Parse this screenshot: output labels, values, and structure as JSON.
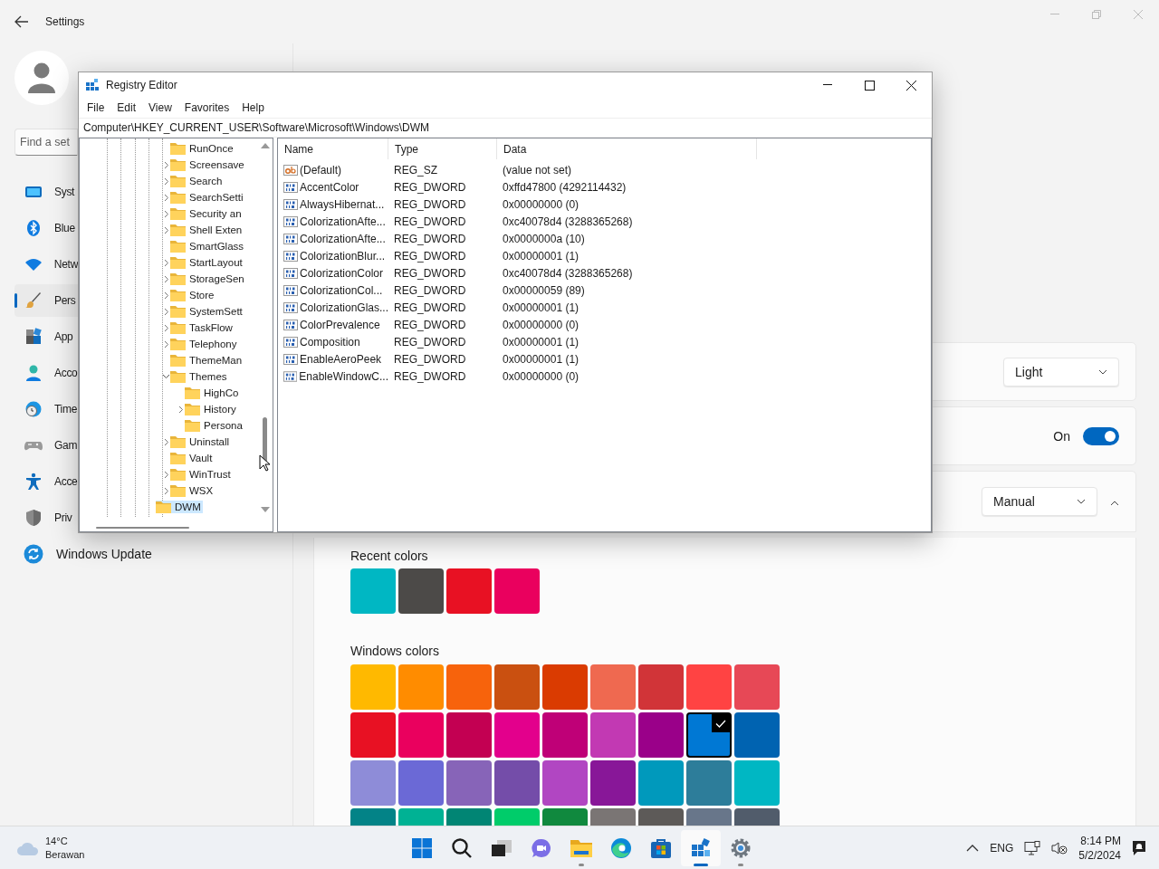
{
  "settings": {
    "title": "Settings",
    "search": {
      "placeholder": "Find a set"
    },
    "nav": [
      {
        "label": "Syst",
        "selected": false
      },
      {
        "label": "Blue",
        "selected": false
      },
      {
        "label": "Netw",
        "selected": false
      },
      {
        "label": "Pers",
        "selected": true
      },
      {
        "label": "App",
        "selected": false
      },
      {
        "label": "Acco",
        "selected": false
      },
      {
        "label": "Time",
        "selected": false
      },
      {
        "label": "Gam",
        "selected": false
      },
      {
        "label": "Acce",
        "selected": false
      },
      {
        "label": "Priv",
        "selected": false
      },
      {
        "label": "Windows Update",
        "selected": false
      }
    ],
    "cards": [
      {
        "kind": "dropdown",
        "value": "Light"
      },
      {
        "kind": "toggle",
        "label": "On",
        "on": true
      },
      {
        "kind": "dropdown",
        "value": "Manual",
        "expanded": true
      }
    ],
    "recent_colors_label": "Recent colors",
    "recent_colors": [
      {
        "color": "#00b7c3"
      },
      {
        "color": "#4c4a48"
      },
      {
        "color": "#e81123"
      },
      {
        "color": "#ea005e"
      }
    ],
    "windows_colors_label": "Windows colors",
    "windows_colors": [
      {
        "color": "#ffb900",
        "selected": false
      },
      {
        "color": "#ff8c00",
        "selected": false
      },
      {
        "color": "#f7630c",
        "selected": false
      },
      {
        "color": "#ca5010",
        "selected": false
      },
      {
        "color": "#da3b01",
        "selected": false
      },
      {
        "color": "#ef6950",
        "selected": false
      },
      {
        "color": "#d13438",
        "selected": false
      },
      {
        "color": "#ff4343",
        "selected": false
      },
      {
        "color": "#e74856",
        "selected": false
      },
      {
        "color": "#e81123",
        "selected": false
      },
      {
        "color": "#ea005e",
        "selected": false
      },
      {
        "color": "#c30052",
        "selected": false
      },
      {
        "color": "#e3008c",
        "selected": false
      },
      {
        "color": "#bf0077",
        "selected": false
      },
      {
        "color": "#c239b3",
        "selected": false
      },
      {
        "color": "#9a0089",
        "selected": false
      },
      {
        "color": "#0078d4",
        "selected": true
      },
      {
        "color": "#0063b1",
        "selected": false
      },
      {
        "color": "#8e8cd8",
        "selected": false
      },
      {
        "color": "#6b69d6",
        "selected": false
      },
      {
        "color": "#8764b8",
        "selected": false
      },
      {
        "color": "#744da9",
        "selected": false
      },
      {
        "color": "#b146c2",
        "selected": false
      },
      {
        "color": "#881798",
        "selected": false
      },
      {
        "color": "#0099bc",
        "selected": false
      },
      {
        "color": "#2d7d9a",
        "selected": false
      },
      {
        "color": "#00b7c3",
        "selected": false
      },
      {
        "color": "#038387",
        "selected": false
      },
      {
        "color": "#00b294",
        "selected": false
      },
      {
        "color": "#018574",
        "selected": false
      },
      {
        "color": "#00cc6a",
        "selected": false
      },
      {
        "color": "#10893e",
        "selected": false
      },
      {
        "color": "#7a7574",
        "selected": false
      },
      {
        "color": "#5d5a58",
        "selected": false
      },
      {
        "color": "#68768a",
        "selected": false
      },
      {
        "color": "#515c6b",
        "selected": false
      }
    ]
  },
  "registry": {
    "title": "Registry Editor",
    "menu": [
      "File",
      "Edit",
      "View",
      "Favorites",
      "Help"
    ],
    "address": "Computer\\HKEY_CURRENT_USER\\Software\\Microsoft\\Windows\\DWM",
    "tree": [
      {
        "children": [
          {
            "label": "RunOnce",
            "selected": false
          },
          {
            "label": "Screensave",
            "expanded": false,
            "selected": false
          },
          {
            "label": "Search",
            "expanded": false,
            "selected": false
          },
          {
            "label": "SearchSetti",
            "expanded": false,
            "selected": false
          },
          {
            "label": "Security an",
            "expanded": false,
            "selected": false
          },
          {
            "label": "Shell Exten",
            "expanded": false,
            "selected": false
          },
          {
            "label": "SmartGlass",
            "selected": false
          },
          {
            "label": "StartLayout",
            "expanded": false,
            "selected": false
          },
          {
            "label": "StorageSen",
            "expanded": false,
            "selected": false
          },
          {
            "label": "Store",
            "expanded": false,
            "selected": false
          },
          {
            "label": "SystemSett",
            "expanded": false,
            "selected": false
          },
          {
            "label": "TaskFlow",
            "expanded": false,
            "selected": false
          },
          {
            "label": "Telephony",
            "expanded": false,
            "selected": false
          },
          {
            "label": "ThemeMan",
            "selected": false
          },
          {
            "label": "Themes",
            "expanded": true,
            "selected": false,
            "children": [
              {
                "label": "HighCo",
                "selected": false
              },
              {
                "label": "History",
                "expanded": false,
                "selected": false
              },
              {
                "label": "Persona",
                "selected": false
              }
            ]
          },
          {
            "label": "Uninstall",
            "expanded": false,
            "selected": false
          },
          {
            "label": "Vault",
            "selected": false
          },
          {
            "label": "WinTrust",
            "expanded": false,
            "selected": false
          },
          {
            "label": "WSX",
            "expanded": false,
            "selected": false
          }
        ]
      },
      {
        "label": "DWM",
        "selected": true
      }
    ],
    "columns": [
      "Name",
      "Type",
      "Data"
    ],
    "values": [
      {
        "kind": "string",
        "name": "(Default)",
        "type": "REG_SZ",
        "data": "(value not set)"
      },
      {
        "kind": "dword",
        "name": "AccentColor",
        "type": "REG_DWORD",
        "data": "0xffd47800 (4292114432)"
      },
      {
        "kind": "dword",
        "name": "AlwaysHibernat...",
        "type": "REG_DWORD",
        "data": "0x00000000 (0)"
      },
      {
        "kind": "dword",
        "name": "ColorizationAfte...",
        "type": "REG_DWORD",
        "data": "0xc40078d4 (3288365268)"
      },
      {
        "kind": "dword",
        "name": "ColorizationAfte...",
        "type": "REG_DWORD",
        "data": "0x0000000a (10)"
      },
      {
        "kind": "dword",
        "name": "ColorizationBlur...",
        "type": "REG_DWORD",
        "data": "0x00000001 (1)"
      },
      {
        "kind": "dword",
        "name": "ColorizationColor",
        "type": "REG_DWORD",
        "data": "0xc40078d4 (3288365268)"
      },
      {
        "kind": "dword",
        "name": "ColorizationCol...",
        "type": "REG_DWORD",
        "data": "0x00000059 (89)"
      },
      {
        "kind": "dword",
        "name": "ColorizationGlas...",
        "type": "REG_DWORD",
        "data": "0x00000001 (1)"
      },
      {
        "kind": "dword",
        "name": "ColorPrevalence",
        "type": "REG_DWORD",
        "data": "0x00000000 (0)"
      },
      {
        "kind": "dword",
        "name": "Composition",
        "type": "REG_DWORD",
        "data": "0x00000001 (1)"
      },
      {
        "kind": "dword",
        "name": "EnableAeroPeek",
        "type": "REG_DWORD",
        "data": "0x00000001 (1)"
      },
      {
        "kind": "dword",
        "name": "EnableWindowC...",
        "type": "REG_DWORD",
        "data": "0x00000000 (0)"
      }
    ]
  },
  "taskbar": {
    "weather": {
      "temperature": "14°C",
      "condition": "Berawan"
    },
    "apps": [
      {
        "running": false,
        "selected": false
      },
      {
        "running": false,
        "selected": false
      },
      {
        "running": false,
        "selected": false
      },
      {
        "running": false,
        "selected": false
      },
      {
        "running": true,
        "selected": false
      },
      {
        "running": false,
        "selected": false
      },
      {
        "running": false,
        "selected": false
      },
      {
        "running": true,
        "selected": true
      },
      {
        "running": true,
        "selected": false
      }
    ],
    "language": "ENG",
    "time": "8:14 PM",
    "date": "5/2/2024"
  }
}
